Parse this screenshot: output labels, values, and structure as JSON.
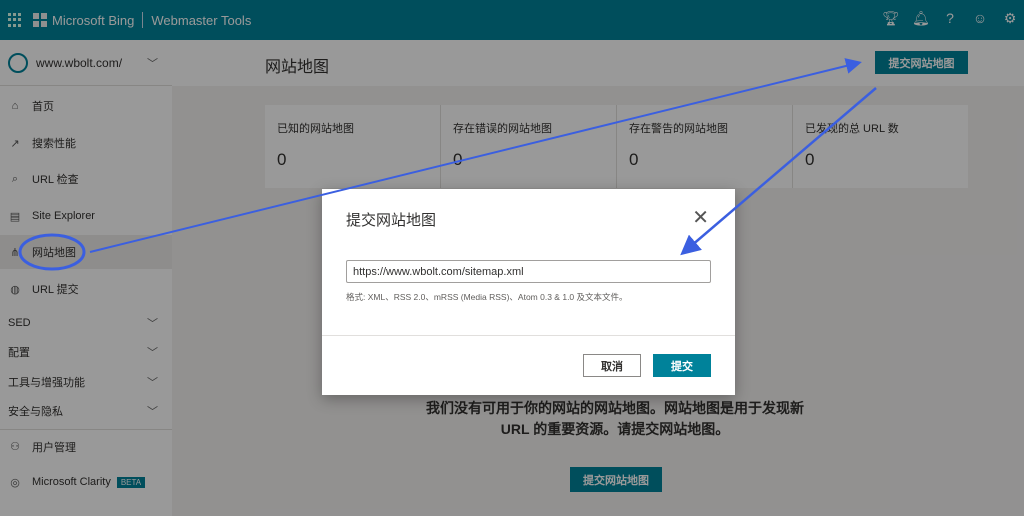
{
  "header": {
    "brand": "Microsoft Bing",
    "product": "Webmaster Tools"
  },
  "sidebar": {
    "site": "www.wbolt.com/",
    "items": [
      {
        "label": "首页",
        "icon": "home-icon"
      },
      {
        "label": "搜索性能",
        "icon": "trend-icon"
      },
      {
        "label": "URL 检查",
        "icon": "search-icon"
      },
      {
        "label": "Site Explorer",
        "icon": "list-icon"
      },
      {
        "label": "网站地图",
        "icon": "sitemap-icon"
      },
      {
        "label": "URL 提交",
        "icon": "globe-icon"
      }
    ],
    "groups": [
      "SED",
      "配置",
      "工具与增强功能",
      "安全与隐私"
    ],
    "user_mgmt": "用户管理",
    "clarity": "Microsoft Clarity",
    "beta": "BETA"
  },
  "main": {
    "title": "网站地图",
    "submit_top": "提交网站地图",
    "stats": [
      {
        "label": "已知的网站地图",
        "value": "0"
      },
      {
        "label": "存在错误的网站地图",
        "value": "0"
      },
      {
        "label": "存在警告的网站地图",
        "value": "0"
      },
      {
        "label": "已发现的总 URL 数",
        "value": "0"
      }
    ],
    "empty_text": "我们没有可用于你的网站的网站地图。网站地图是用于发现新 URL 的重要资源。请提交网站地图。",
    "submit_bottom": "提交网站地图"
  },
  "dialog": {
    "title": "提交网站地图",
    "url": "https://www.wbolt.com/sitemap.xml",
    "hint": "格式: XML、RSS 2.0、mRSS (Media RSS)、Atom 0.3 & 1.0 及文本文件。",
    "cancel": "取消",
    "submit": "提交"
  },
  "colors": {
    "accent": "#00829a",
    "annotation": "#3b5fe0"
  }
}
